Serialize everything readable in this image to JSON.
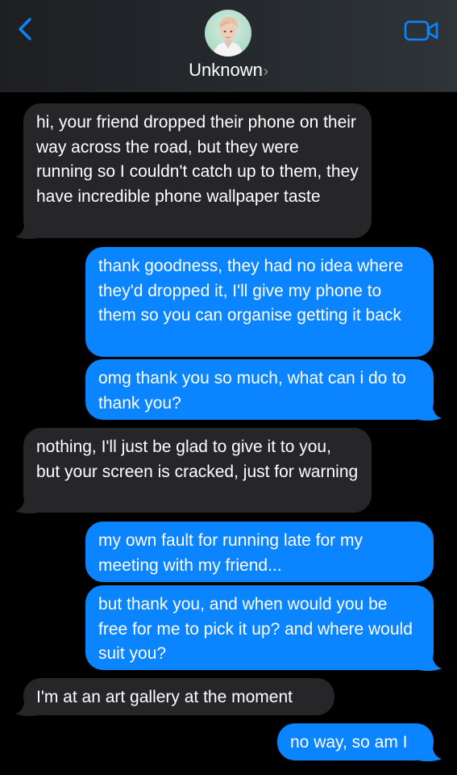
{
  "header": {
    "contact_name": "Unknown",
    "chevron": "›",
    "back_icon": "chevron-left-icon",
    "video_icon": "video-camera-icon",
    "accent_color": "#0a84ff"
  },
  "colors": {
    "sent_bubble": "#0a84ff",
    "received_bubble": "#262628",
    "background": "#000000"
  },
  "messages": [
    {
      "direction": "received",
      "text": "hi, your friend dropped their phone on their way across the road, but they were running so I couldn't catch up to them, they have incredible phone wallpaper taste"
    },
    {
      "direction": "sent",
      "text": "thank goodness, they had no idea where they'd dropped it, I'll give my phone to them so you can organise getting it back"
    },
    {
      "direction": "sent",
      "text": "omg thank you so much, what can i do to thank you?"
    },
    {
      "direction": "received",
      "text": "nothing, I'll just be glad to give it to you, but your screen is cracked, just for warning"
    },
    {
      "direction": "sent",
      "text": "my own fault for running late for my meeting with my friend..."
    },
    {
      "direction": "sent",
      "text": "but thank you, and when would you be free for me to pick it up? and where would suit you?"
    },
    {
      "direction": "received",
      "text": "I'm at an art gallery at the moment"
    },
    {
      "direction": "sent",
      "text": "no way, so am I"
    }
  ]
}
